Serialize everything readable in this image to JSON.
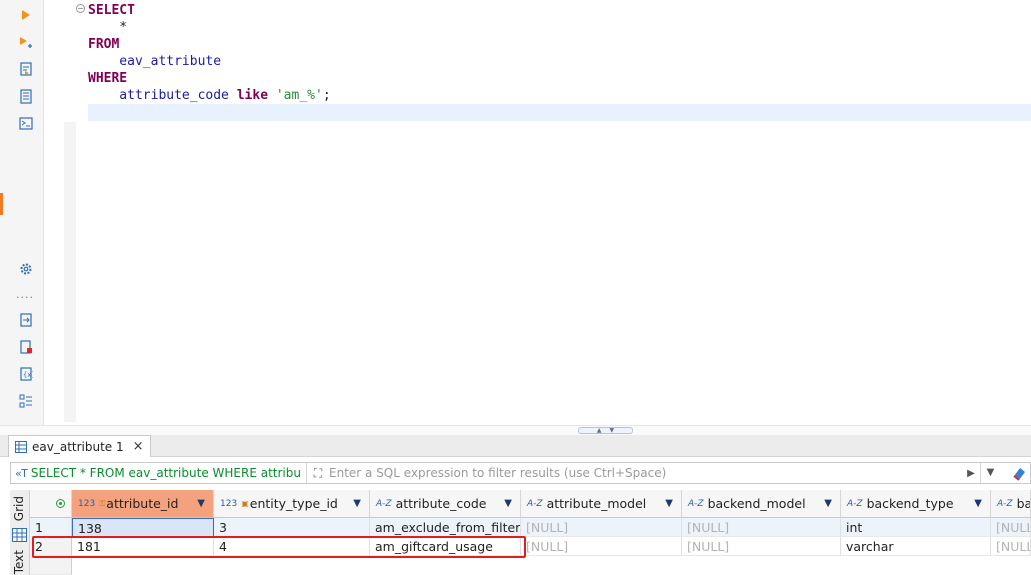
{
  "editor": {
    "lines": [
      {
        "parts": [
          {
            "cls": "kw",
            "text": "SELECT"
          }
        ]
      },
      {
        "parts": [
          {
            "cls": "punct",
            "text": "    *"
          }
        ]
      },
      {
        "parts": [
          {
            "cls": "kw",
            "text": "FROM"
          }
        ]
      },
      {
        "parts": [
          {
            "cls": "ident",
            "text": "    eav_attribute"
          }
        ]
      },
      {
        "parts": [
          {
            "cls": "kw",
            "text": "WHERE"
          }
        ]
      },
      {
        "parts": [
          {
            "cls": "ident",
            "text": "    attribute_code "
          },
          {
            "cls": "kw",
            "text": "like"
          },
          {
            "cls": "punct",
            "text": " "
          },
          {
            "cls": "str",
            "text": "'am_%'"
          },
          {
            "cls": "punct",
            "text": ";"
          }
        ]
      }
    ]
  },
  "results_tab": {
    "label": "eav_attribute 1",
    "close": "×"
  },
  "filter": {
    "query": "SELECT * FROM eav_attribute WHERE attribu",
    "placeholder": "Enter a SQL expression to filter results (use Ctrl+Space)"
  },
  "side_tabs": {
    "grid": "Grid",
    "text": "Text"
  },
  "grid": {
    "columns": [
      {
        "label": "attribute_id",
        "type": "123",
        "pk": true,
        "selected": true
      },
      {
        "label": "entity_type_id",
        "type": "123",
        "fk": true
      },
      {
        "label": "attribute_code",
        "type": "A-Z"
      },
      {
        "label": "attribute_model",
        "type": "A-Z"
      },
      {
        "label": "backend_model",
        "type": "A-Z"
      },
      {
        "label": "backend_type",
        "type": "A-Z"
      },
      {
        "label": "backe",
        "type": "A-Z"
      }
    ],
    "rows": [
      {
        "num": "1",
        "cells": [
          "138",
          "3",
          "am_exclude_from_filter",
          "[NULL]",
          "[NULL]",
          "int",
          "[NULL]"
        ]
      },
      {
        "num": "2",
        "cells": [
          "181",
          "4",
          "am_giftcard_usage",
          "[NULL]",
          "[NULL]",
          "varchar",
          "[NULL]"
        ]
      }
    ]
  },
  "colors": {
    "keyword": "#7f0055",
    "identifier": "#1a1aa6",
    "string": "#2a8a3a",
    "selected_header": "#f4a27e",
    "highlight": "#e21d1d"
  },
  "icons": [
    "run-icon",
    "run-new-tab-icon",
    "explain-plan-icon",
    "script-icon",
    "console-icon",
    "settings-icon",
    "export-icon",
    "error-file-icon",
    "variables-icon",
    "outline-icon",
    "filter-eraser-icon",
    "grid-icon"
  ]
}
